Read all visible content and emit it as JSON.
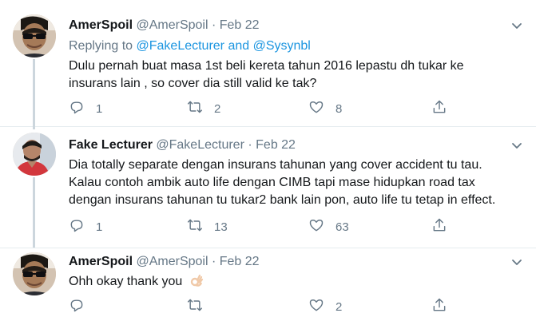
{
  "tweets": [
    {
      "name": "AmerSpoil",
      "handle": "@AmerSpoil",
      "separator": "·",
      "date": "Feb 22",
      "reply_prefix": "Replying to",
      "reply_users": "@FakeLecturer and @Sysynbl",
      "text_lines": [
        "Dulu pernah buat masa 1st beli kereta tahun 2016 lepastu dh tukar ke",
        "insurans lain , so cover dia still valid ke tak?"
      ],
      "replies": "1",
      "retweets": "2",
      "likes": "8"
    },
    {
      "name": "Fake Lecturer",
      "handle": "@FakeLecturer",
      "separator": "·",
      "date": "Feb 22",
      "text_lines": [
        "Dia totally separate dengan insurans tahunan yang cover accident tu tau.",
        "Kalau contoh ambik auto life dengan CIMB tapi mase hidupkan road tax",
        "dengan insurans tahunan tu tukar2 bank lain pon, auto life tu tetap in effect."
      ],
      "replies": "1",
      "retweets": "13",
      "likes": "63"
    },
    {
      "name": "AmerSpoil",
      "handle": "@AmerSpoil",
      "separator": "·",
      "date": "Feb 22",
      "text": "Ohh okay thank you",
      "emoji": "ok-hand-emoji",
      "replies": "",
      "retweets": "",
      "likes": "2"
    }
  ],
  "colors": {
    "text": "#14171a",
    "secondary": "#657786",
    "link": "#1b95e0",
    "thread_line": "#ccd6dd",
    "divider": "#e6ecf0"
  },
  "icons": [
    "reply-icon",
    "retweet-icon",
    "like-icon",
    "share-icon",
    "caret-down-icon"
  ]
}
